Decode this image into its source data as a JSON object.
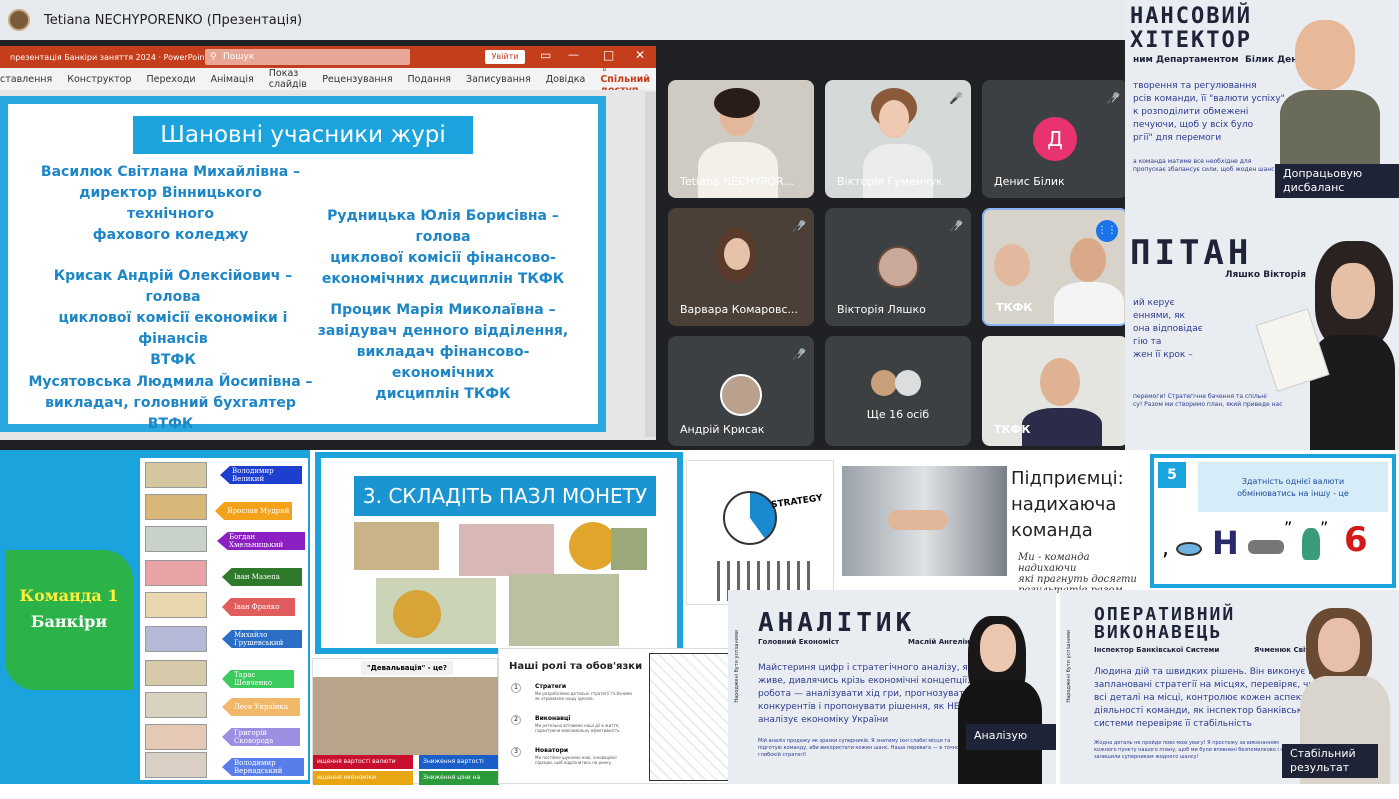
{
  "meeting": {
    "title": "Tetiana NECHYPORENKO (Презентація)",
    "ppt": {
      "file_title": "презентація Банкіри заняття 2024 · PowerPoint",
      "search_placeholder": "Пошук",
      "login": "Увійти",
      "ribbon": [
        "ставлення",
        "Конструктор",
        "Переходи",
        "Анімація",
        "Показ слайдів",
        "Рецензування",
        "Подання",
        "Записування",
        "Довідка"
      ],
      "share": "Спільний доступ",
      "slide": {
        "title": "Шановні учасники журі",
        "jury": [
          "Василюк Світлана Михайлівна –\nдиректор Вінницького технічного\nфахового коледжу",
          "Рудницька Юлія Борисівна – голова\nциклової комісії фінансово-\nекономічних дисциплін ТКФК",
          "Крисак Андрій Олексійович – голова\nциклової комісії економіки і фінансів\nВТФК",
          "Процик Марія Миколаївна –\nзавідувач денного відділення,\nвикладач фінансово-економічних\nдисциплін ТКФК",
          "Мусятовська Людмила Йосипівна –\nвикладач, головний бухгалтер ВТФК"
        ]
      }
    },
    "participants": [
      {
        "name": "Tetiana NECHYPOR..."
      },
      {
        "name": "Вікторія Гуменчук"
      },
      {
        "name": "Денис Білик",
        "initial": "Д"
      },
      {
        "name": "Варвара Комаровс..."
      },
      {
        "name": "Вікторія Ляшко"
      },
      {
        "name": "ТКФК"
      },
      {
        "name": "Андрій Крисак"
      },
      {
        "name": "Ще 16 осіб"
      },
      {
        "name": "ТКФК"
      }
    ]
  },
  "cards": {
    "financier": {
      "title_l1": "НАНСОВИЙ",
      "title_l2": "ХІТЕКТОР",
      "subtitle": "ним Департаментом",
      "person": "Білик Денис",
      "text": "творення та регулювання\nрсів команди, її \"валюти успіху\".\nк розподілити обмежені\nпечуючи, щоб у всіх було\nргії\" для перемоги",
      "footer": "а команда матиме все необхідне для\nпропускає збалансує сили, щоб жоден шанс",
      "badge": "Допрацьовую\nдисбаланс"
    },
    "strategist": {
      "title": "ПІТАН",
      "person": "Ляшко Вікторія",
      "text": "ий керує\nеннями, як\nона відповідає\nгію та\nжен її крок –",
      "footer": "перемоги! Стратегічне бачення та спільні\nсу! Разом ми створимо план, який приведе нас"
    },
    "analyst": {
      "title": "АНАЛІТИК",
      "role": "Головний Економіст",
      "person": "Маслій Ангеліна",
      "text": "Майстериня цифр і стратегічного аналізу, яка\nживе, дивлячись крізь економічні концепції. Її\nробота — аналізувати хід гри, прогнозувати дії\nконкурентів і пропонувати рішення, як НБУ\nаналізує економіку України",
      "footer": "Мій аналіз продажу як зразки суперників. Я знатиму їхні слабкі місця та\nпідготую команду, аби використати кожен шанс. Наша перевага — в точності та\nглибокій стратегії",
      "badge": "Аналізую",
      "side": "Народжені бути успішними"
    },
    "operative": {
      "title_l1": "ОПЕРАТИВНИЙ",
      "title_l2": "ВИКОНАВЕЦЬ",
      "role": "Інспектор Банківської Системи",
      "person": "Ячменюк Світлана",
      "text": "Людина дій та швидких рішень. Він виконує всі\nзаплановані стратегії на місцях, перевіряє, чи\nвсі деталі на місці, контролює кожен аспект\nдіяльності команди, як інспектор банківської\nсистеми перевіряє її стабільність",
      "footer": "Жодна деталь не пройде повз мою увагу! Я простежу за виконанням\nкожного пункту нашого плану, щоб ми були впевнені безпомилково і не\nзалишили суперникам жодного шансу!",
      "badge": "Стабільний\nрезультат",
      "side": "Народжені бути успішними"
    },
    "entrepreneurs": {
      "title": "Підприємці:\nнадихаюча\nкоманда",
      "text": "Ми - команда надихаючи\nякі прагнуть досягти\nрезультатів разом. Наш"
    },
    "rebus": {
      "number": "5",
      "question": "Здатність однієї валюти\nобмінюватись на іншу - це",
      "glyphs": [
        ",",
        "Н",
        "”",
        "”",
        "6"
      ]
    },
    "strategy": {
      "label": "STRATEGY"
    }
  },
  "bottom": {
    "team": {
      "title": "Команда 1",
      "subtitle": "Банкіри"
    },
    "banknotes": [
      "Володимир Великий",
      "Ярослав Мудрий",
      "Богдан Хмельницький",
      "Іван Мазепа",
      "Іван Франко",
      "Михайло Грушевський",
      "Тарас Шевченко",
      "Леся Українка",
      "Григорій Сковорода",
      "Володимир Вернадський"
    ],
    "puzzle": {
      "title": "3. СКЛАДІТЬ ПАЗЛ МОНЕТУ"
    },
    "devaluation": {
      "title": "\"Девальвація\" - це?",
      "options": [
        "ищення вартості валюти",
        "Зниження вартості валюти",
        "ищення економіки",
        "Зниження ціни на товари"
      ]
    },
    "roles": {
      "title": "Наші ролі та обов'язки",
      "items": [
        {
          "num": "1",
          "head": "Стратеги",
          "text": "Ми розробляємо детальні стратегії та бачимо як отримаємо нашу ідеалів."
        },
        {
          "num": "2",
          "head": "Виконавці",
          "text": "Ми ретельно втілюємо наші дії в життя, гарантуючи максимальну ефективність."
        },
        {
          "num": "3",
          "head": "Новатори",
          "text": "Ми постійно шукаємо нові, інноваційні підходи, щоб відрізнитись на ринку."
        }
      ]
    }
  }
}
